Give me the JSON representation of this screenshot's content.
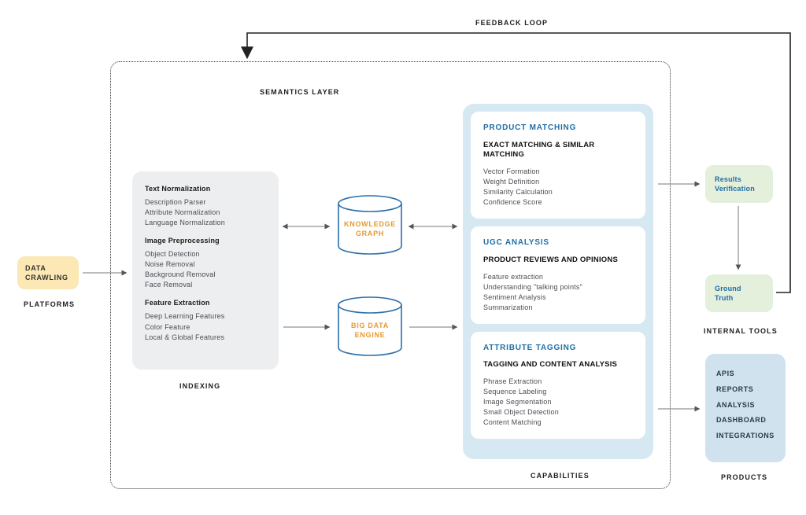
{
  "feedback_loop_label": "FEEDBACK LOOP",
  "semantics_layer_label": "SEMANTICS LAYER",
  "platforms_label": "PLATFORMS",
  "indexing_label": "INDEXING",
  "capabilities_label": "CAPABILITIES",
  "internal_tools_label": "INTERNAL TOOLS",
  "products_label": "PRODUCTS",
  "data_crawling": {
    "title_l1": "DATA",
    "title_l2": "CRAWLING"
  },
  "indexing": {
    "h1": "Text Normalization",
    "h1_items": [
      "Description Parser",
      "Attribute Normalization",
      "Language Normalization"
    ],
    "h2": "Image Preprocessing",
    "h2_items": [
      "Object Detection",
      "Noise Removal",
      "Background Removal",
      "Face Removal"
    ],
    "h3": "Feature Extraction",
    "h3_items": [
      "Deep Learning Features",
      "Color Feature",
      "Local & Global Features"
    ]
  },
  "cylinders": {
    "knowledge_graph_l1": "KNOWLEDGE",
    "knowledge_graph_l2": "GRAPH",
    "big_data_l1": "BIG DATA",
    "big_data_l2": "ENGINE"
  },
  "capabilities": {
    "product_matching": {
      "title": "PRODUCT MATCHING",
      "subtitle": "EXACT MATCHING & SIMILAR MATCHING",
      "items": [
        "Vector Formation",
        "Weight Definition",
        "Similarity Calculation",
        "Confidence Score"
      ]
    },
    "ugc_analysis": {
      "title": "UGC ANALYSIS",
      "subtitle": "PRODUCT REVIEWS AND OPINIONS",
      "items": [
        "Feature extraction",
        "Understanding \"talking points\"",
        "Sentiment Analysis",
        "Summarization"
      ]
    },
    "attribute_tagging": {
      "title": "ATTRIBUTE TAGGING",
      "subtitle": "TAGGING AND CONTENT ANALYSIS",
      "items": [
        "Phrase Extraction",
        "Sequence Labeling",
        "Image Segmentation",
        "Small Object Detection",
        "Content Matching"
      ]
    }
  },
  "internal_tools": {
    "results_l1": "Results",
    "results_l2": "Verification",
    "ground_l1": "Ground",
    "ground_l2": "Truth"
  },
  "products": {
    "items": [
      "APIS",
      "REPORTS",
      "ANALYSIS",
      "DASHBOARD",
      "INTEGRATIONS"
    ]
  }
}
